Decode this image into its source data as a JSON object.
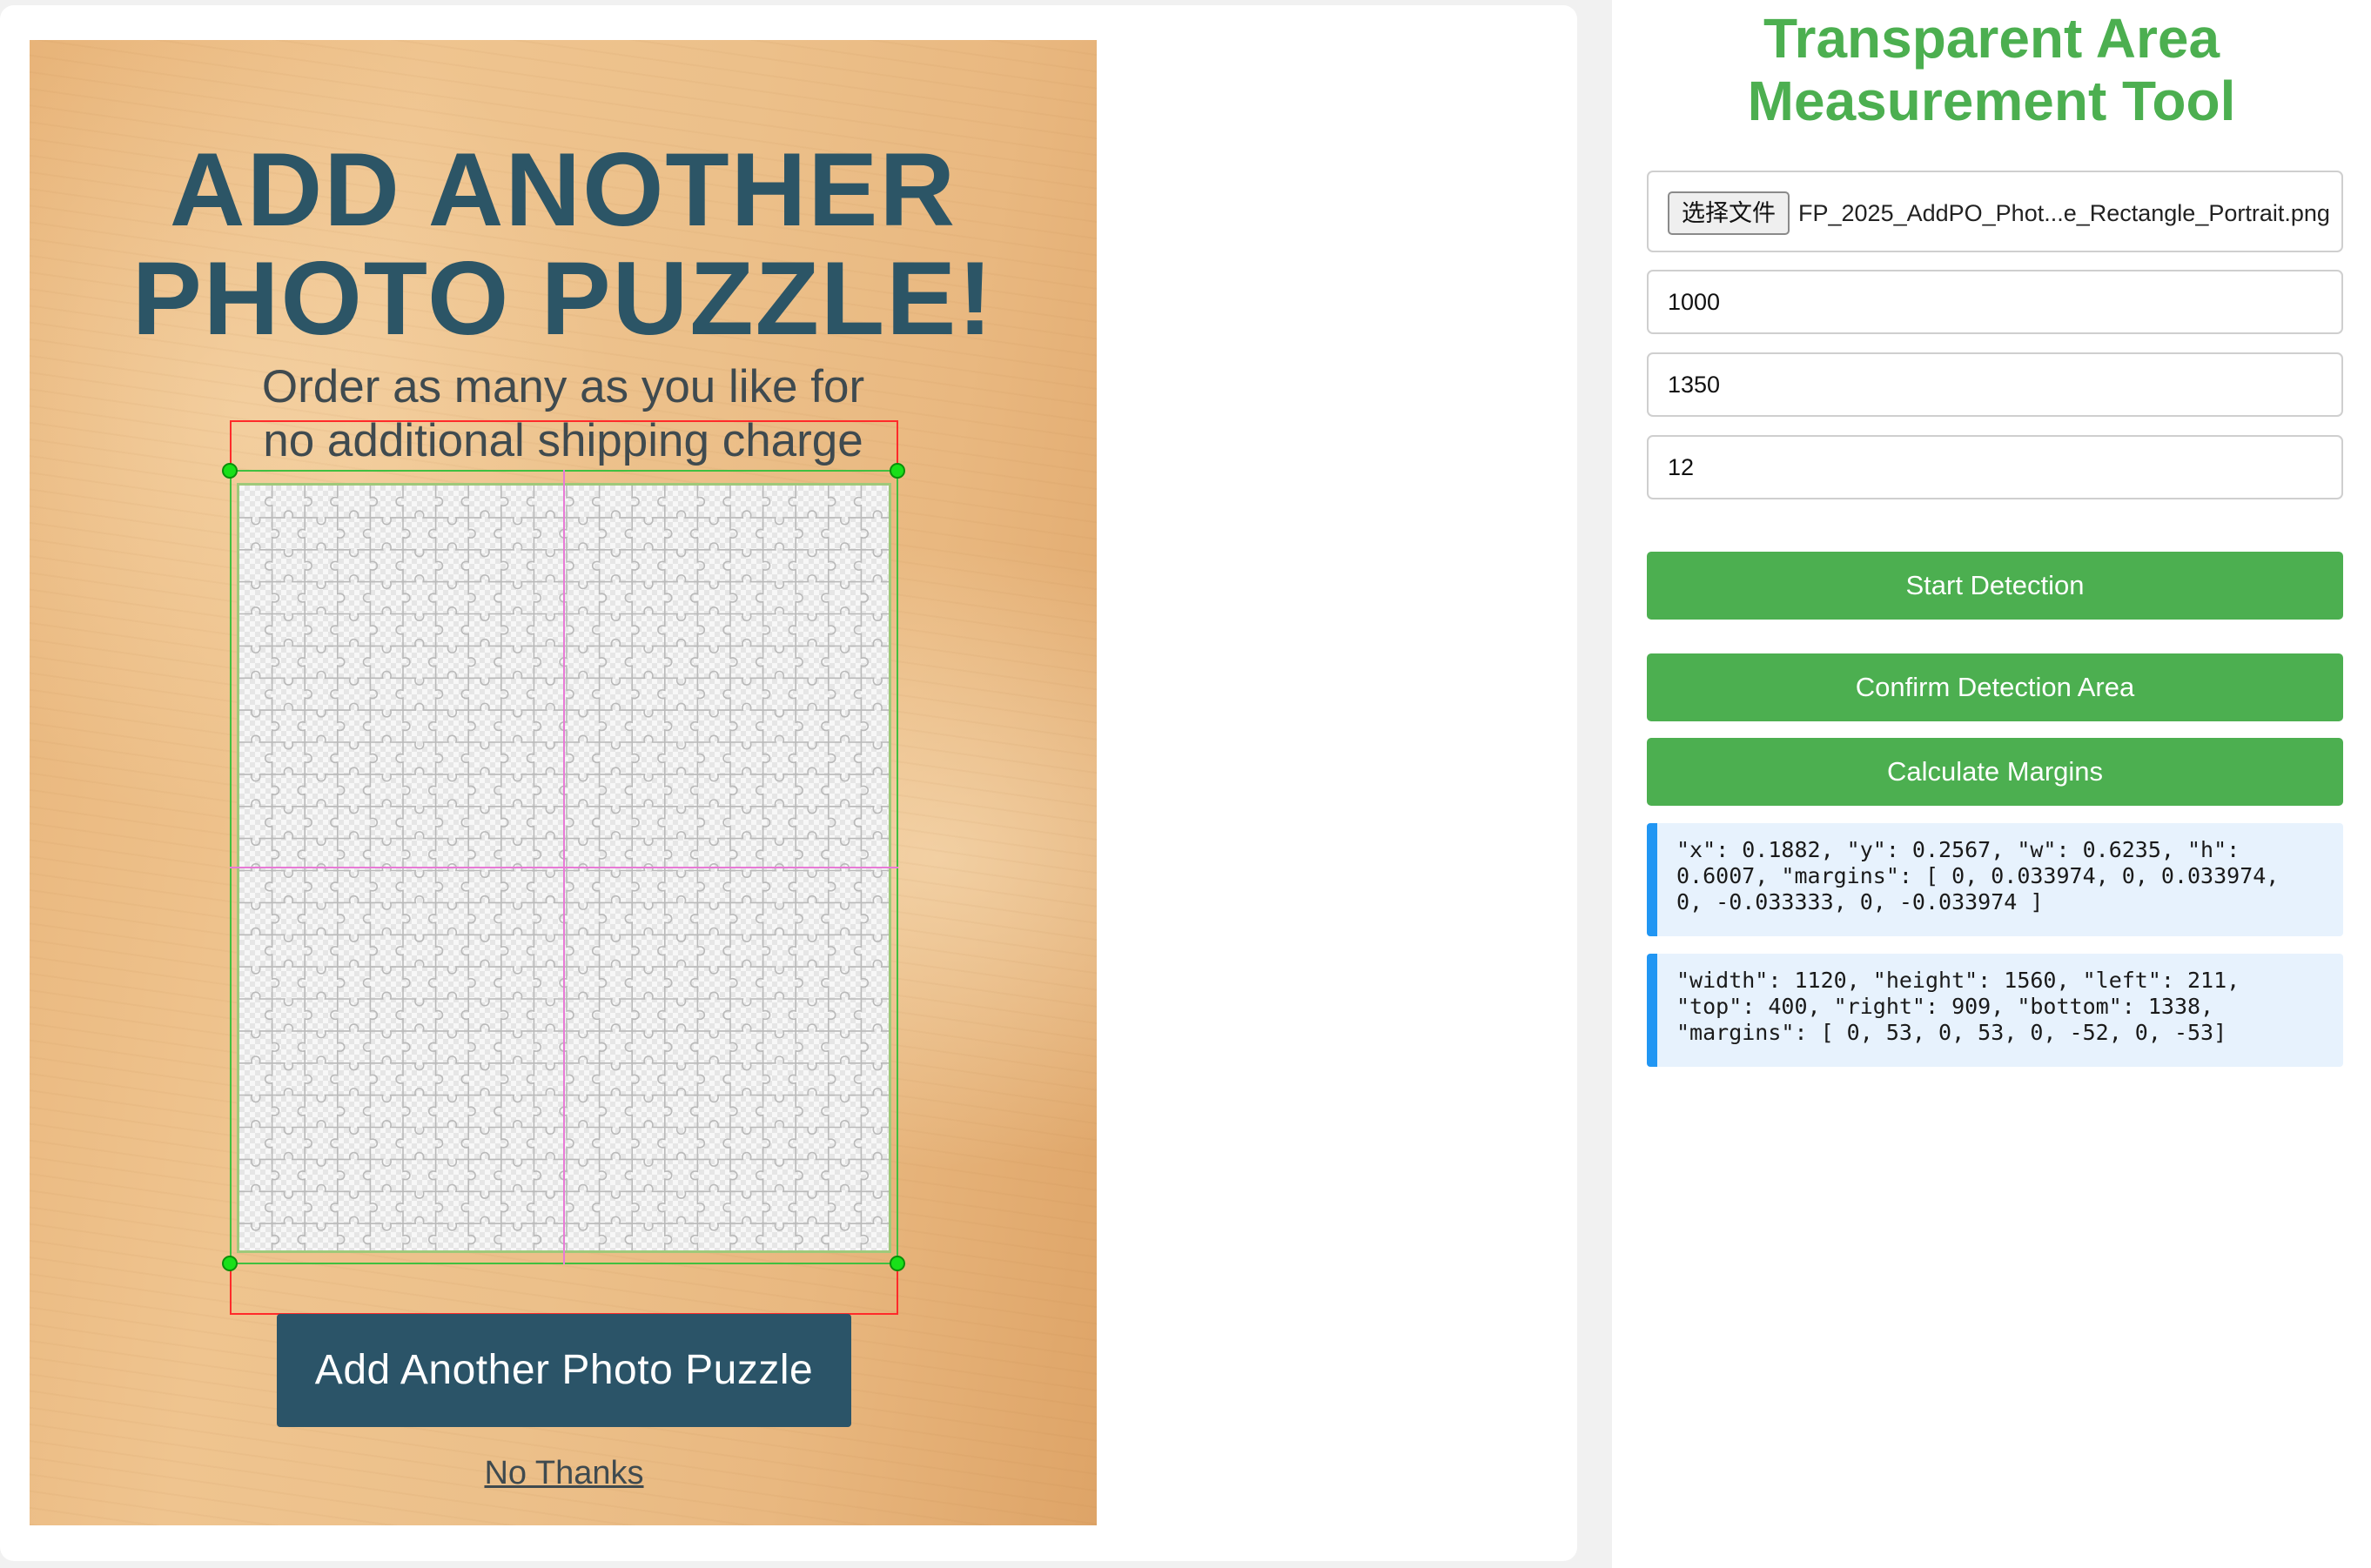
{
  "poster": {
    "title_line1": "ADD ANOTHER",
    "title_line2": "PHOTO PUZZLE!",
    "subtitle_line1": "Order as many as you like for",
    "subtitle_line2": "no additional shipping charge",
    "cta_label": "Add Another Photo Puzzle",
    "dismiss_label": "No Thanks",
    "title_color": "#2c5566",
    "cta_color": "#2b5468"
  },
  "overlay": {
    "detection_rect_color": "#ff2a2a",
    "content_rect_color": "#40c040",
    "guide_color": "#e87ad6",
    "handle_color": "#19e019"
  },
  "panel": {
    "title_line1": "Transparent Area",
    "title_line2": "Measurement Tool",
    "title_color": "#4caf50",
    "file_button_label": "选择文件",
    "file_name": "FP_2025_AddPO_Phot...e_Rectangle_Portrait.png",
    "width_value": "1000",
    "height_value": "1350",
    "margin_value": "12",
    "start_label": "Start Detection",
    "confirm_label": "Confirm Detection Area",
    "calculate_label": "Calculate Margins",
    "button_color": "#4caf50",
    "result_normalized": "\"x\": 0.1882, \"y\": 0.2567, \"w\": 0.6235, \"h\":\n0.6007, \"margins\": [ 0, 0.033974, 0, 0.033974,\n0, -0.033333, 0, -0.033974 ]",
    "result_pixels": "\"width\": 1120, \"height\": 1560, \"left\": 211,\n\"top\": 400, \"right\": 909, \"bottom\": 1338,\n\"margins\": [ 0, 53, 0, 53, 0, -52, 0, -53]",
    "result_accent": "#2196f3"
  }
}
